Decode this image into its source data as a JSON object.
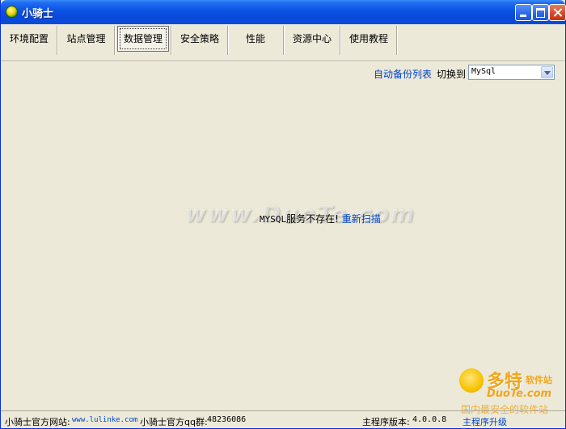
{
  "window": {
    "title": "小骑士"
  },
  "tabs": [
    {
      "label": "环境配置",
      "active": false
    },
    {
      "label": "站点管理",
      "active": false
    },
    {
      "label": "数据管理",
      "active": true
    },
    {
      "label": "安全策略",
      "active": false
    },
    {
      "label": "性能",
      "active": false
    },
    {
      "label": "资源中心",
      "active": false
    },
    {
      "label": "使用教程",
      "active": false
    }
  ],
  "controls": {
    "backup_link": "自动备份列表",
    "switch_label": "切换到",
    "db_select": {
      "selected": "MySql"
    }
  },
  "message": {
    "service": "MYSQL",
    "text": "服务不存在!",
    "rescan": "重新扫描"
  },
  "watermark": {
    "center": "www.DuoTe.com",
    "brand": "多特",
    "brand_suffix": "软件站",
    "url": "DuoTe.com",
    "tagline": "国内最安全的软件站"
  },
  "status": {
    "site_label": "小骑士官方网站:",
    "site_url": "www.lulinke.com",
    "qq_label": "小骑士官方qq群:",
    "qq_value": "48236086",
    "version_label": "主程序版本:",
    "version_value": "4.0.0.8",
    "upgrade": "主程序升级"
  },
  "colors": {
    "titlebar": "#0A52E3",
    "background": "#ECE9D8",
    "link": "#0044CC",
    "watermark": "#F2A51C"
  }
}
